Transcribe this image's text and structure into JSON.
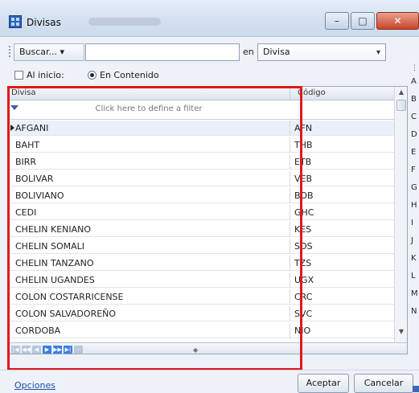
{
  "window": {
    "title": "Divisas",
    "controls": {
      "minimize": "–",
      "maximize": "□",
      "close": "✕"
    }
  },
  "toolbar": {
    "search_button_label": "Buscar... ▾",
    "search_value": "",
    "in_label": "en",
    "field_select_value": "Divisa",
    "field_select_arrow": "▾"
  },
  "options": {
    "starts_with_label": "Al inicio:",
    "contains_label": "En Contenido",
    "selected": "En Contenido"
  },
  "grid": {
    "columns": [
      "Divisa",
      "Código"
    ],
    "filter_hint": "Click here to define a filter",
    "current_row": 0,
    "rows": [
      {
        "name": "AFGANI",
        "code": "AFN"
      },
      {
        "name": "BAHT",
        "code": "THB"
      },
      {
        "name": "BIRR",
        "code": "ETB"
      },
      {
        "name": "BOLIVAR",
        "code": "VEB"
      },
      {
        "name": "BOLIVIANO",
        "code": "BOB"
      },
      {
        "name": "CEDI",
        "code": "GHC"
      },
      {
        "name": "CHELIN KENIANO",
        "code": "KES"
      },
      {
        "name": "CHELIN SOMALI",
        "code": "SOS"
      },
      {
        "name": "CHELIN TANZANO",
        "code": "TZS"
      },
      {
        "name": "CHELIN UGANDES",
        "code": "UGX"
      },
      {
        "name": "COLON COSTARRICENSE",
        "code": "CRC"
      },
      {
        "name": "COLON SALVADOREÑO",
        "code": "SVC"
      },
      {
        "name": "CORDOBA",
        "code": "NIO"
      }
    ]
  },
  "side_index": [
    "A",
    "B",
    "C",
    "D",
    "E",
    "F",
    "G",
    "H",
    "I",
    "J",
    "K",
    "L",
    "M",
    "N"
  ],
  "footer": {
    "options_link": "Opciones",
    "accept_label": "Aceptar",
    "cancel_label": "Cancelar"
  },
  "colors": {
    "highlight": "#e0191a",
    "accent": "#3b7ee0"
  }
}
